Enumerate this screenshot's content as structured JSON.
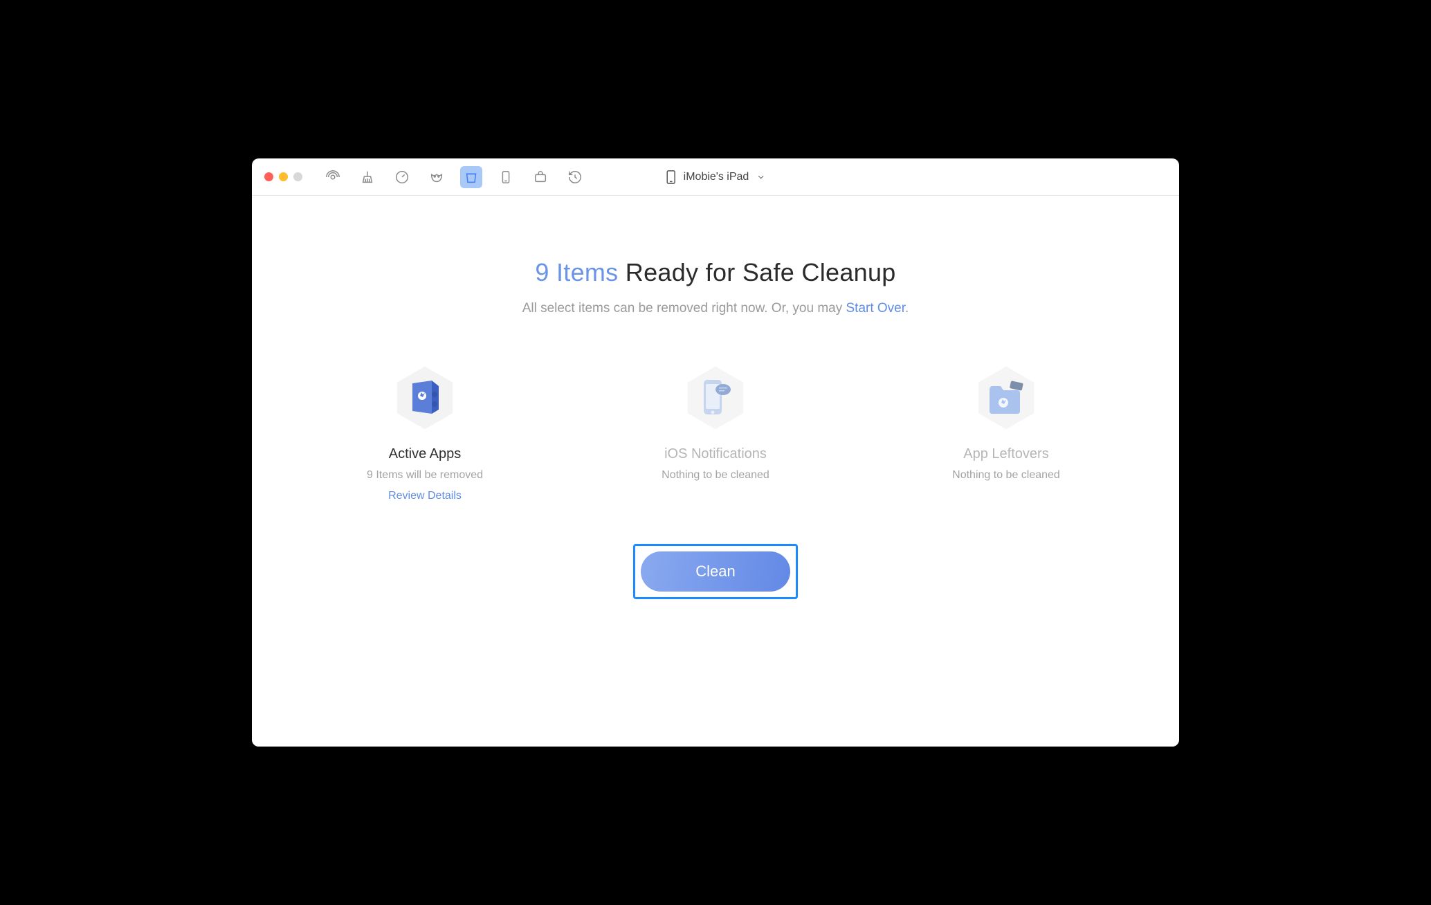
{
  "device": {
    "name": "iMobie's iPad"
  },
  "toolbar": {
    "icons": [
      "airplay",
      "broom",
      "globe",
      "mask",
      "trash",
      "phone",
      "briefcase",
      "history"
    ],
    "active_index": 4
  },
  "headline": {
    "count_text": "9 Items",
    "rest": " Ready for Safe Cleanup"
  },
  "subline": {
    "prefix": "All select items can be removed right now. Or, you may ",
    "link": "Start Over",
    "suffix": "."
  },
  "cards": [
    {
      "id": "active-apps",
      "title": "Active Apps",
      "sub": "9 Items will be removed",
      "link": "Review Details",
      "disabled": false
    },
    {
      "id": "ios-notifications",
      "title": "iOS Notifications",
      "sub": "Nothing to be cleaned",
      "link": "",
      "disabled": true
    },
    {
      "id": "app-leftovers",
      "title": "App Leftovers",
      "sub": "Nothing to be cleaned",
      "link": "",
      "disabled": true
    }
  ],
  "action": {
    "clean_label": "Clean"
  },
  "colors": {
    "accent": "#6b94e8",
    "highlight_border": "#1a8cff",
    "disabled_text": "#b5b5b5"
  }
}
